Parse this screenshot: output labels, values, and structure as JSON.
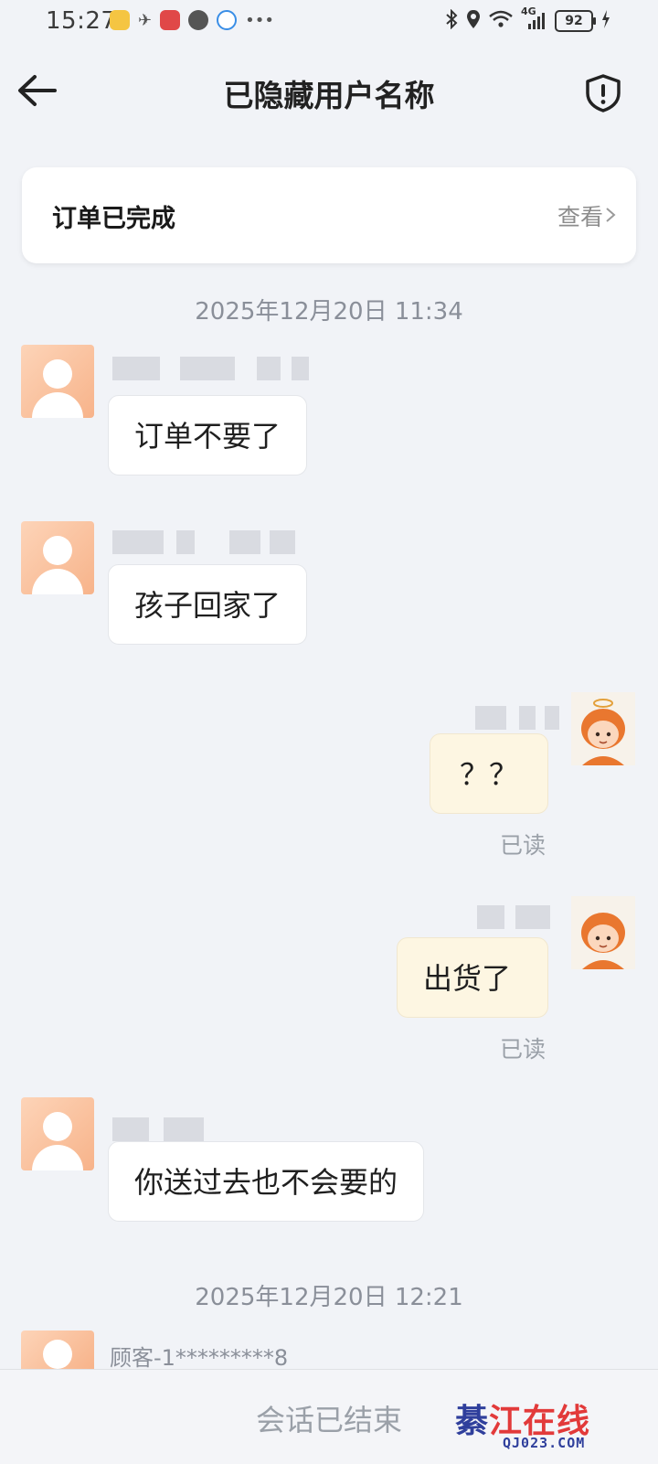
{
  "status_bar": {
    "time": "15:27",
    "signal_label": "4G",
    "battery": "92"
  },
  "header": {
    "title": "已隐藏用户名称"
  },
  "order_card": {
    "title": "订单已完成",
    "view_label": "查看"
  },
  "timestamps": [
    "2025年12月20日 11:34",
    "2025年12月20日 12:21"
  ],
  "messages": [
    {
      "side": "left",
      "text": "订单不要了"
    },
    {
      "side": "left",
      "text": "孩子回家了"
    },
    {
      "side": "right",
      "text": "？？",
      "status": "已读"
    },
    {
      "side": "right",
      "text": "出货了",
      "status": "已读"
    },
    {
      "side": "left",
      "text": "你送过去也不会要的"
    }
  ],
  "last_sender_name": "顾客-1*********8",
  "bottom_bar": {
    "session_ended": "会话已结束"
  },
  "watermark": {
    "cn": "江在线",
    "cn_first": "綦",
    "en": "QJ023.COM"
  },
  "colors": {
    "background": "#f1f3f7",
    "right_bubble": "#fdf6e2",
    "left_bubble": "#ffffff",
    "avatar": "#f7b38a"
  }
}
